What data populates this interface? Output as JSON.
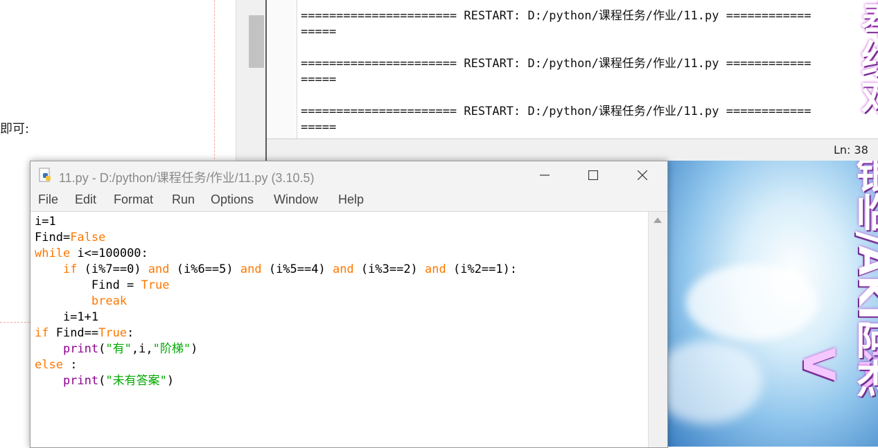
{
  "background_doc": {
    "fragment": "即可:"
  },
  "shell": {
    "lines": [
      "====================== RESTART: D:/python/课程任务/作业/11.py ============",
      "=====",
      "",
      "====================== RESTART: D:/python/课程任务/作业/11.py ============",
      "=====",
      "",
      "====================== RESTART: D:/python/课程任务/作业/11.py ============",
      "====="
    ],
    "status": "Ln: 38"
  },
  "editor": {
    "title": "11.py - D:/python/课程任务/作业/11.py (3.10.5)",
    "menu": [
      "File",
      "Edit",
      "Format",
      "Run",
      "Options",
      "Window",
      "Help"
    ],
    "code": [
      [
        {
          "t": "i=1"
        }
      ],
      [
        {
          "t": "Find="
        },
        {
          "t": "False",
          "c": "kw"
        }
      ],
      [
        {
          "t": "while",
          "c": "kw"
        },
        {
          "t": " i<=100000:"
        }
      ],
      [
        {
          "t": "    "
        },
        {
          "t": "if",
          "c": "kw"
        },
        {
          "t": " (i%7==0) "
        },
        {
          "t": "and",
          "c": "kw"
        },
        {
          "t": " (i%6==5) "
        },
        {
          "t": "and",
          "c": "kw"
        },
        {
          "t": " (i%5==4) "
        },
        {
          "t": "and",
          "c": "kw"
        },
        {
          "t": " (i%3==2) "
        },
        {
          "t": "and",
          "c": "kw"
        },
        {
          "t": " (i%2==1):"
        }
      ],
      [
        {
          "t": "        Find = "
        },
        {
          "t": "True",
          "c": "kw"
        }
      ],
      [
        {
          "t": "        "
        },
        {
          "t": "break",
          "c": "kw"
        }
      ],
      [
        {
          "t": "    i=1+1"
        }
      ],
      [
        {
          "t": "if",
          "c": "kw"
        },
        {
          "t": " Find=="
        },
        {
          "t": "True",
          "c": "kw"
        },
        {
          "t": ":"
        }
      ],
      [
        {
          "t": "    "
        },
        {
          "t": "print",
          "c": "bi"
        },
        {
          "t": "("
        },
        {
          "t": "\"有\"",
          "c": "st"
        },
        {
          "t": ",i,"
        },
        {
          "t": "\"阶梯\"",
          "c": "st"
        },
        {
          "t": ")"
        }
      ],
      [
        {
          "t": "else",
          "c": "kw"
        },
        {
          "t": " :"
        }
      ],
      [
        {
          "t": "    "
        },
        {
          "t": "print",
          "c": "bi"
        },
        {
          "t": "("
        },
        {
          "t": "\"未有答案\"",
          "c": "st"
        },
        {
          "t": ")"
        }
      ]
    ]
  },
  "wallpaper": {
    "lyric_top": "奉纺戏",
    "lyric_right": "银临/AKI阿杰",
    "lyric_left": "词：V"
  },
  "colors": {
    "keyword": "#ff7700",
    "builtin": "#900090",
    "string": "#00aa00"
  }
}
